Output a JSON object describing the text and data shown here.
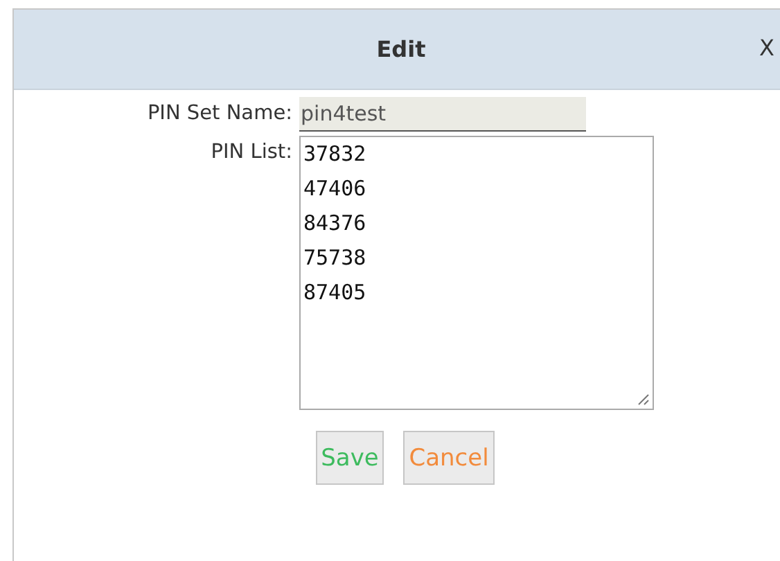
{
  "dialog": {
    "title": "Edit",
    "close": "X"
  },
  "fields": {
    "pin_set_name": {
      "label": "PIN Set Name:",
      "value": "pin4test",
      "disabled": true
    },
    "pin_list": {
      "label": "PIN List:",
      "values": [
        "37832",
        "47406",
        "84376",
        "75738",
        "87405"
      ]
    }
  },
  "buttons": [
    {
      "label": "Save",
      "kind": "save"
    },
    {
      "label": "Cancel",
      "kind": "cancel"
    }
  ]
}
